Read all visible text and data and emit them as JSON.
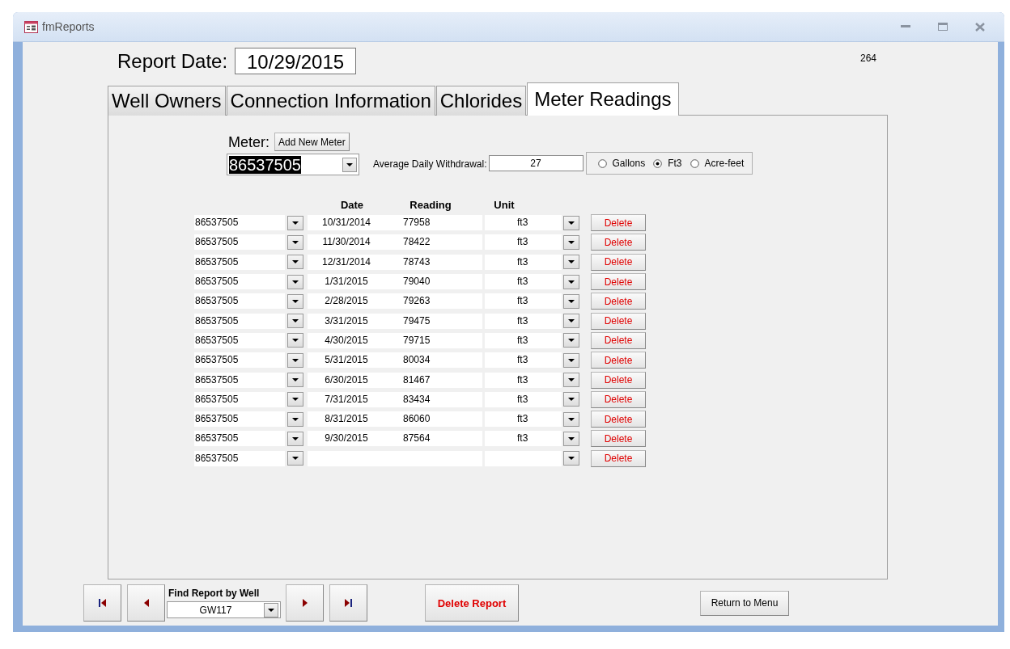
{
  "window": {
    "title": "fmReports"
  },
  "report_date": {
    "label": "Report Date:",
    "value": "10/29/2015"
  },
  "record_number": "264",
  "tabs": [
    {
      "label": "Well Owners",
      "selected": false
    },
    {
      "label": "Connection Information",
      "selected": false
    },
    {
      "label": "Chlorides",
      "selected": false
    },
    {
      "label": "Meter Readings",
      "selected": true
    }
  ],
  "meter": {
    "label": "Meter:",
    "add_button": "Add New Meter",
    "value": "86537505"
  },
  "average_daily_withdrawal": {
    "label": "Average Daily Withdrawal:",
    "value": "27"
  },
  "units": [
    {
      "label": "Gallons",
      "selected": false
    },
    {
      "label": "Ft3",
      "selected": true
    },
    {
      "label": "Acre-feet",
      "selected": false
    }
  ],
  "table": {
    "columns": [
      "Date",
      "Reading",
      "Unit"
    ],
    "rows": [
      {
        "meter": "86537505",
        "date": "10/31/2014",
        "reading": "77958",
        "unit": "ft3",
        "delete": "Delete"
      },
      {
        "meter": "86537505",
        "date": "11/30/2014",
        "reading": "78422",
        "unit": "ft3",
        "delete": "Delete"
      },
      {
        "meter": "86537505",
        "date": "12/31/2014",
        "reading": "78743",
        "unit": "ft3",
        "delete": "Delete"
      },
      {
        "meter": "86537505",
        "date": "1/31/2015",
        "reading": "79040",
        "unit": "ft3",
        "delete": "Delete"
      },
      {
        "meter": "86537505",
        "date": "2/28/2015",
        "reading": "79263",
        "unit": "ft3",
        "delete": "Delete"
      },
      {
        "meter": "86537505",
        "date": "3/31/2015",
        "reading": "79475",
        "unit": "ft3",
        "delete": "Delete"
      },
      {
        "meter": "86537505",
        "date": "4/30/2015",
        "reading": "79715",
        "unit": "ft3",
        "delete": "Delete"
      },
      {
        "meter": "86537505",
        "date": "5/31/2015",
        "reading": "80034",
        "unit": "ft3",
        "delete": "Delete"
      },
      {
        "meter": "86537505",
        "date": "6/30/2015",
        "reading": "81467",
        "unit": "ft3",
        "delete": "Delete"
      },
      {
        "meter": "86537505",
        "date": "7/31/2015",
        "reading": "83434",
        "unit": "ft3",
        "delete": "Delete"
      },
      {
        "meter": "86537505",
        "date": "8/31/2015",
        "reading": "86060",
        "unit": "ft3",
        "delete": "Delete"
      },
      {
        "meter": "86537505",
        "date": "9/30/2015",
        "reading": "87564",
        "unit": "ft3",
        "delete": "Delete"
      },
      {
        "meter": "86537505",
        "delete": "Delete"
      }
    ]
  },
  "navigation": {
    "find_label": "Find Report by Well",
    "find_value": "GW117",
    "delete_report": "Delete Report",
    "return_to_menu": "Return to Menu"
  }
}
